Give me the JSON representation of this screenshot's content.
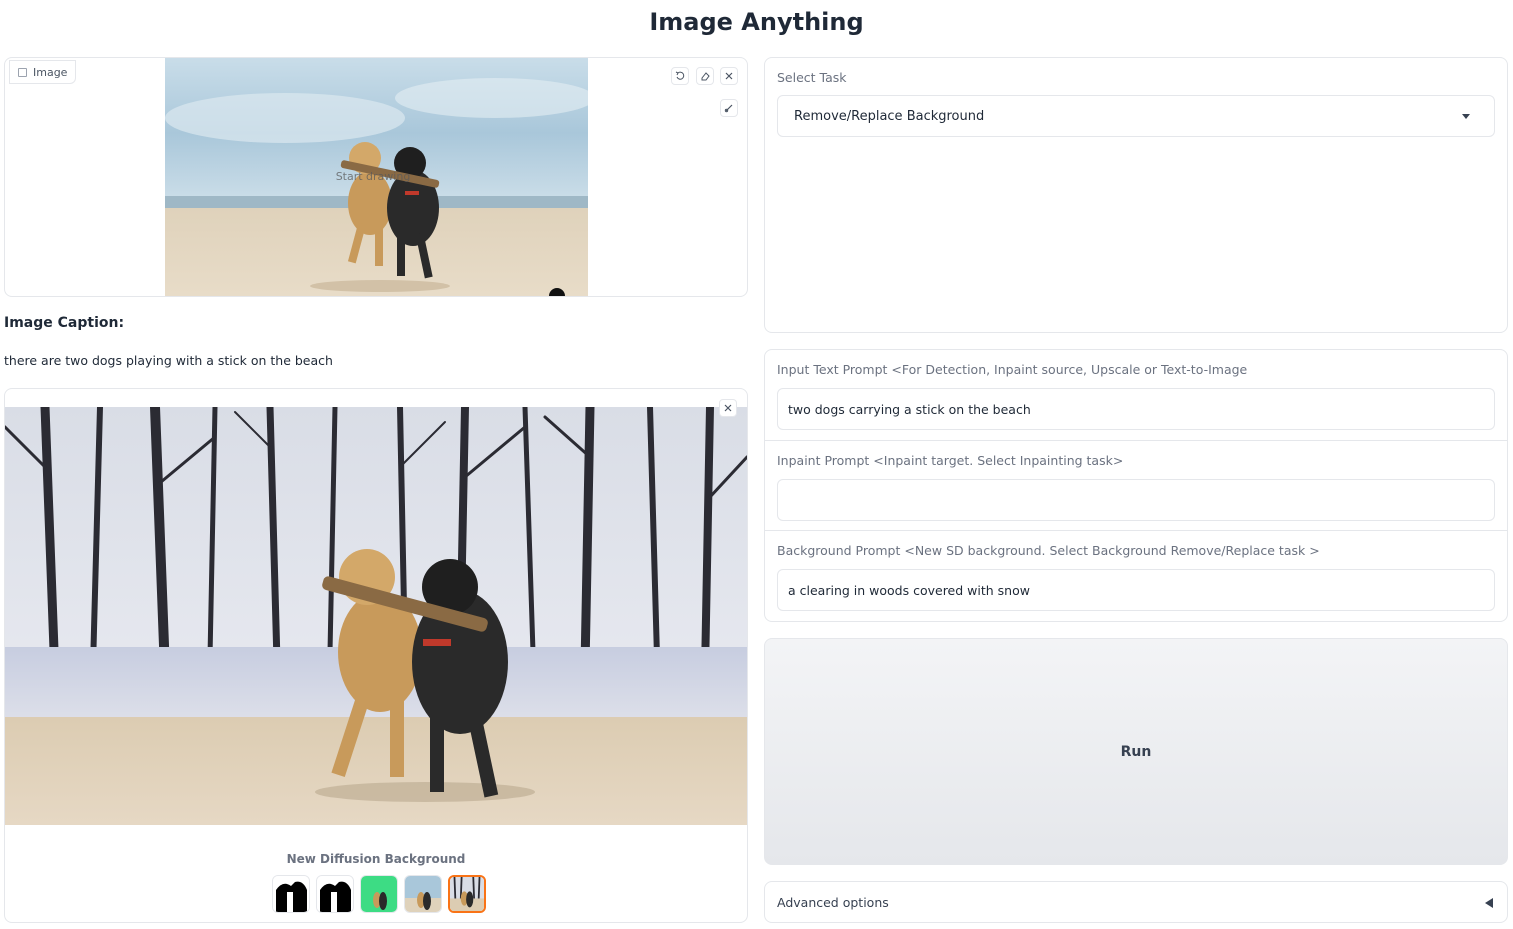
{
  "app": {
    "title": "Image Anything"
  },
  "input_image": {
    "label": "Image",
    "overlay_text": "Start drawing"
  },
  "caption": {
    "title": "Image Caption:",
    "text": "there are two dogs playing with a stick on the beach"
  },
  "output": {
    "gallery_caption": "New Diffusion Background",
    "selected_thumb_index": 4,
    "accent_color": "#f97316"
  },
  "task": {
    "label": "Select Task",
    "selected": "Remove/Replace Background"
  },
  "prompts": {
    "text_prompt_label": "Input Text Prompt <For Detection, Inpaint source, Upscale or Text-to-Image",
    "text_prompt_value": "two dogs carrying a stick on the beach",
    "inpaint_label": "Inpaint Prompt <Inpaint target. Select Inpainting task>",
    "inpaint_value": "",
    "background_label": "Background Prompt <New SD background. Select Background Remove/Replace task >",
    "background_value": "a clearing in woods covered with snow"
  },
  "run": {
    "label": "Run"
  },
  "advanced": {
    "label": "Advanced options"
  }
}
